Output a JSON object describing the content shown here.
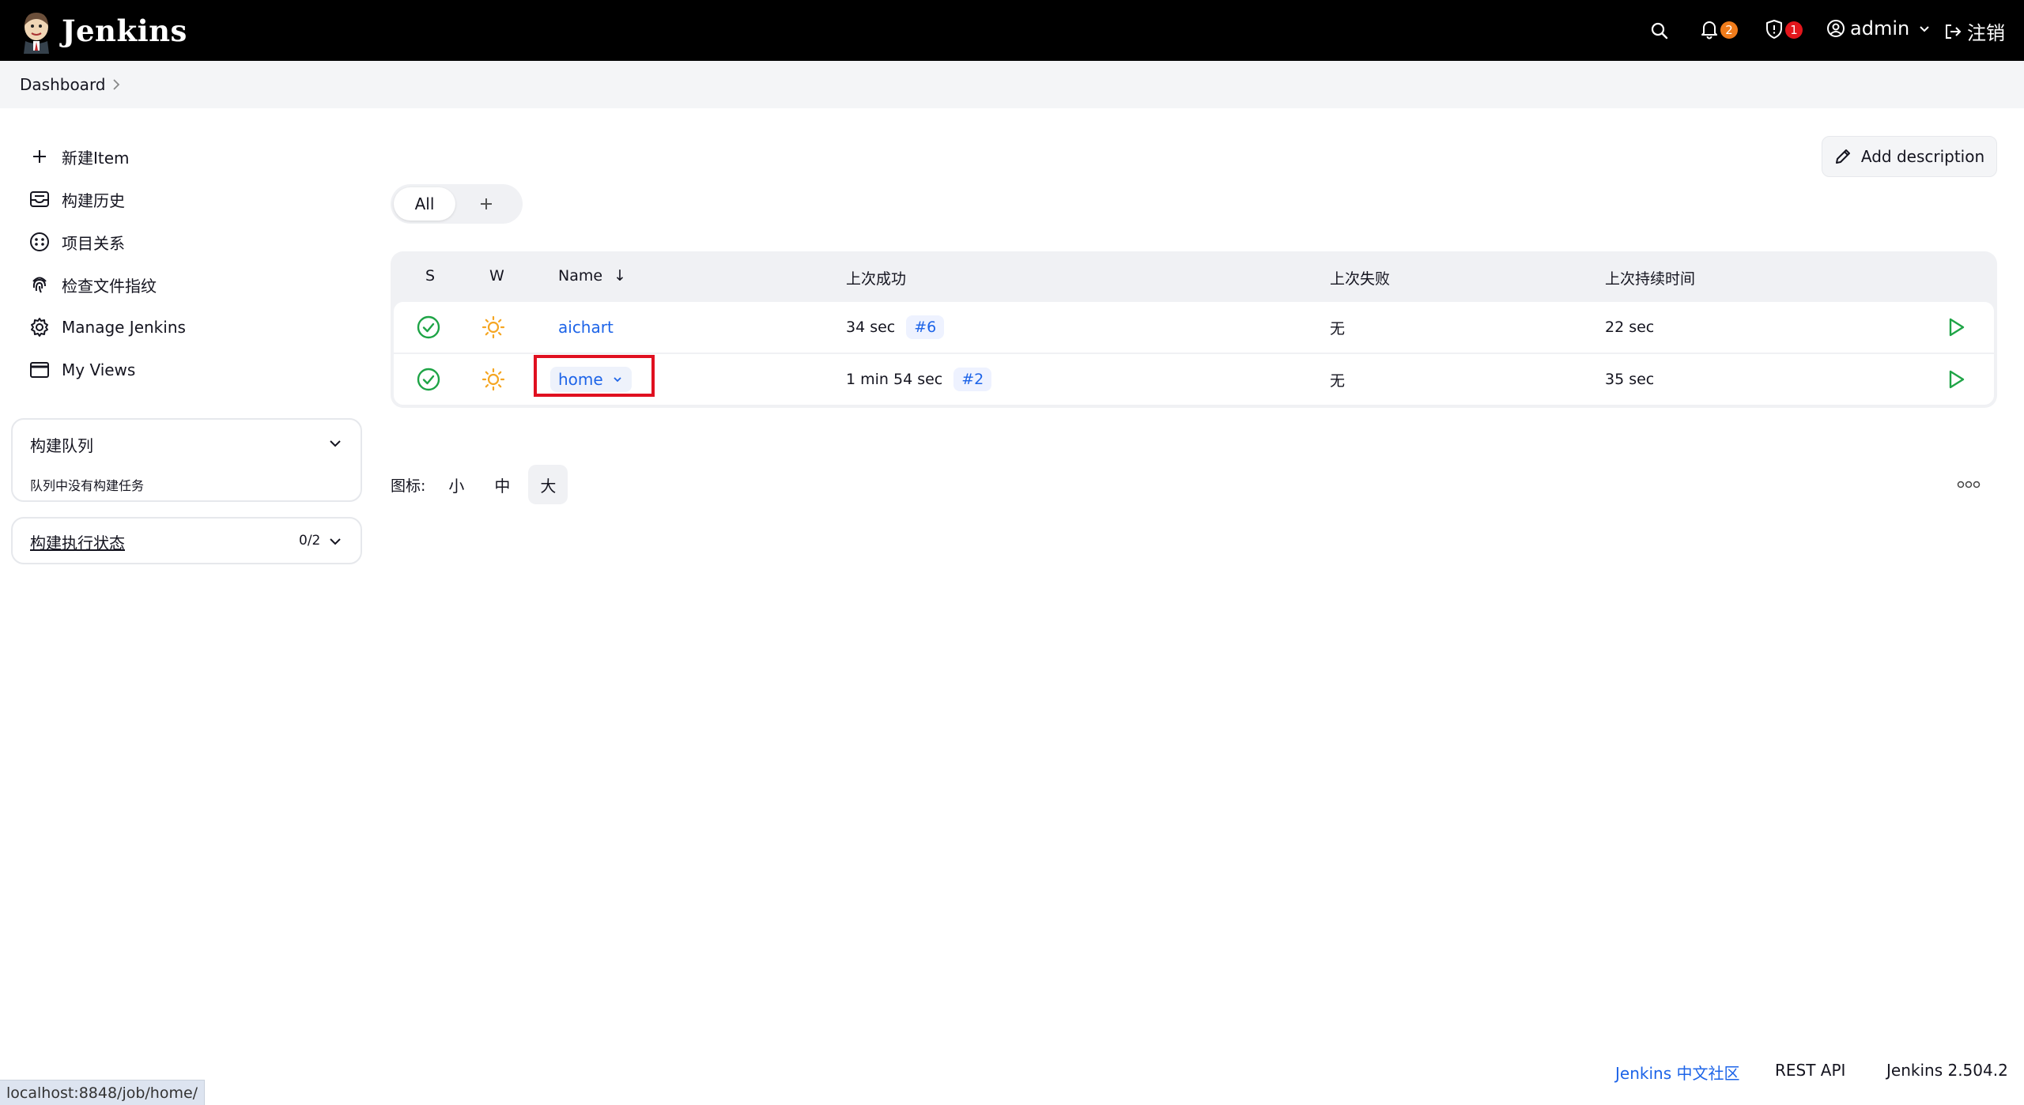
{
  "header": {
    "brand": "Jenkins",
    "notifications_count": "2",
    "security_count": "1",
    "user": "admin",
    "logout": "注销",
    "colors": {
      "bar": "#000000",
      "notify_badge": "#f07c1b",
      "security_badge": "#e3161c"
    }
  },
  "breadcrumb": {
    "dashboard": "Dashboard"
  },
  "sidebar": {
    "tasks": [
      {
        "label": "新建Item",
        "icon": "plus-icon"
      },
      {
        "label": "构建历史",
        "icon": "inbox-icon"
      },
      {
        "label": "项目关系",
        "icon": "relationship-icon"
      },
      {
        "label": "检查文件指纹",
        "icon": "fingerprint-icon"
      },
      {
        "label": "Manage Jenkins",
        "icon": "gear-icon"
      },
      {
        "label": "My Views",
        "icon": "window-icon"
      }
    ],
    "build_queue": {
      "title": "构建队列",
      "empty": "队列中没有构建任务"
    },
    "executors": {
      "title": "构建执行状态",
      "count": "0/2"
    }
  },
  "main": {
    "add_description": "Add description",
    "tabs": {
      "all": "All"
    },
    "table": {
      "headers": {
        "s": "S",
        "w": "W",
        "name": "Name",
        "sort_arrow": "↓",
        "last_success": "上次成功",
        "last_failure": "上次失败",
        "last_duration": "上次持续时间"
      },
      "rows": [
        {
          "name": "aichart",
          "last_success": "34 sec",
          "build": "#6",
          "last_failure": "无",
          "duration": "22 sec"
        },
        {
          "name": "home",
          "last_success": "1 min 54 sec",
          "build": "#2",
          "last_failure": "无",
          "duration": "35 sec"
        }
      ]
    },
    "icon_size": {
      "label": "图标:",
      "small": "小",
      "medium": "中",
      "large": "大"
    }
  },
  "footer": {
    "community": "Jenkins 中文社区",
    "rest_api": "REST API",
    "version": "Jenkins 2.504.2"
  },
  "status_bar": {
    "url": "localhost:8848/job/home/"
  }
}
